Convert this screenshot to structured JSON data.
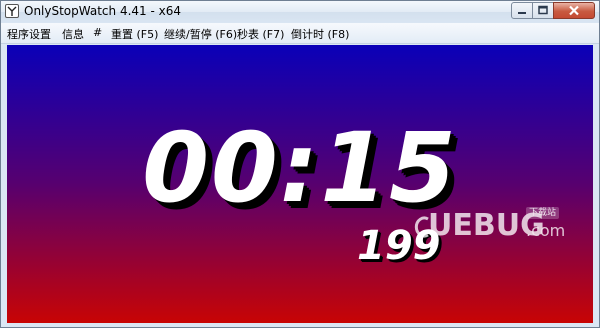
{
  "window": {
    "title": "OnlyStopWatch 4.41 - x64",
    "icon": "stopwatch-app-icon",
    "controls": [
      "minimize-icon",
      "maximize-icon",
      "close-icon"
    ]
  },
  "menu": {
    "items": [
      {
        "label": "程序设置"
      },
      {
        "label": "信息"
      },
      {
        "label": "#"
      },
      {
        "label": "重置 (F5)"
      },
      {
        "label": "继续/暂停 (F6)"
      },
      {
        "label": "秒表 (F7)"
      },
      {
        "label": "倒计时 (F8)"
      }
    ]
  },
  "display": {
    "time": "00:15",
    "milliseconds": "199",
    "background_top_color": "#0a00b8",
    "background_bottom_color": "#c80404",
    "text_color": "#ffffff",
    "shadow_color": "#000000"
  },
  "watermark": {
    "brand": "UEBUG",
    "suffix": ".com",
    "badge": "下载站"
  }
}
